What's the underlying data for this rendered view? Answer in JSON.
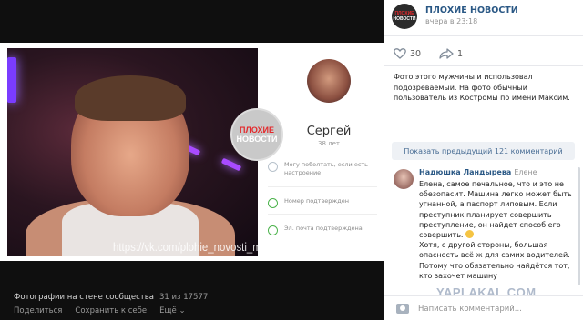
{
  "photo": {
    "watermark": "https://vk.com/plohie_novosti_mc",
    "logo": {
      "line1": "ПЛОХИЕ",
      "line2": "НОВОСТИ"
    },
    "profile_card": {
      "name": "Сергей",
      "age": "38 лет",
      "row1": "Могу поболтать, если есть настроение",
      "row2": "Номер подтвержден",
      "row3": "Эл. почта подтверждена"
    }
  },
  "viewer": {
    "caption": "Фотографии на стене сообщества",
    "counter": "31 из 17577",
    "actions": {
      "share": "Поделиться",
      "save": "Сохранить к себе",
      "more": "Ещё ⌄"
    }
  },
  "post": {
    "publisher": "ПЛОХИЕ НОВОСТИ",
    "time": "вчера в 23:18",
    "likes": "30",
    "shares": "1",
    "description": "Фото этого мужчины и использовал подозреваемый. На фото обычный пользователь из Костромы по имени Максим.",
    "show_previous": "Показать предыдущий 121 комментарий"
  },
  "comment": {
    "author": "Надюшка Ландырева",
    "reply_to": "Елене",
    "text_part1": "Елена, самое печальное, что и это не обезопасит. Машина легко может быть угнанной, а паспорт липовым. Если преступник планирует совершить преступление, он найдет способ его совершить.",
    "text_part2": "Хотя, с другой стороны, большая опасность всё ж для самих водителей. Потому что обязательно найдётся тот, кто захочет машину"
  },
  "input": {
    "placeholder": "Написать комментарий..."
  },
  "watermark_site": "YAPLAKAL.COM",
  "colors": {
    "link": "#2a5885",
    "viewer_bg": "#0f0f0f",
    "panel_bg": "#ffffff"
  }
}
